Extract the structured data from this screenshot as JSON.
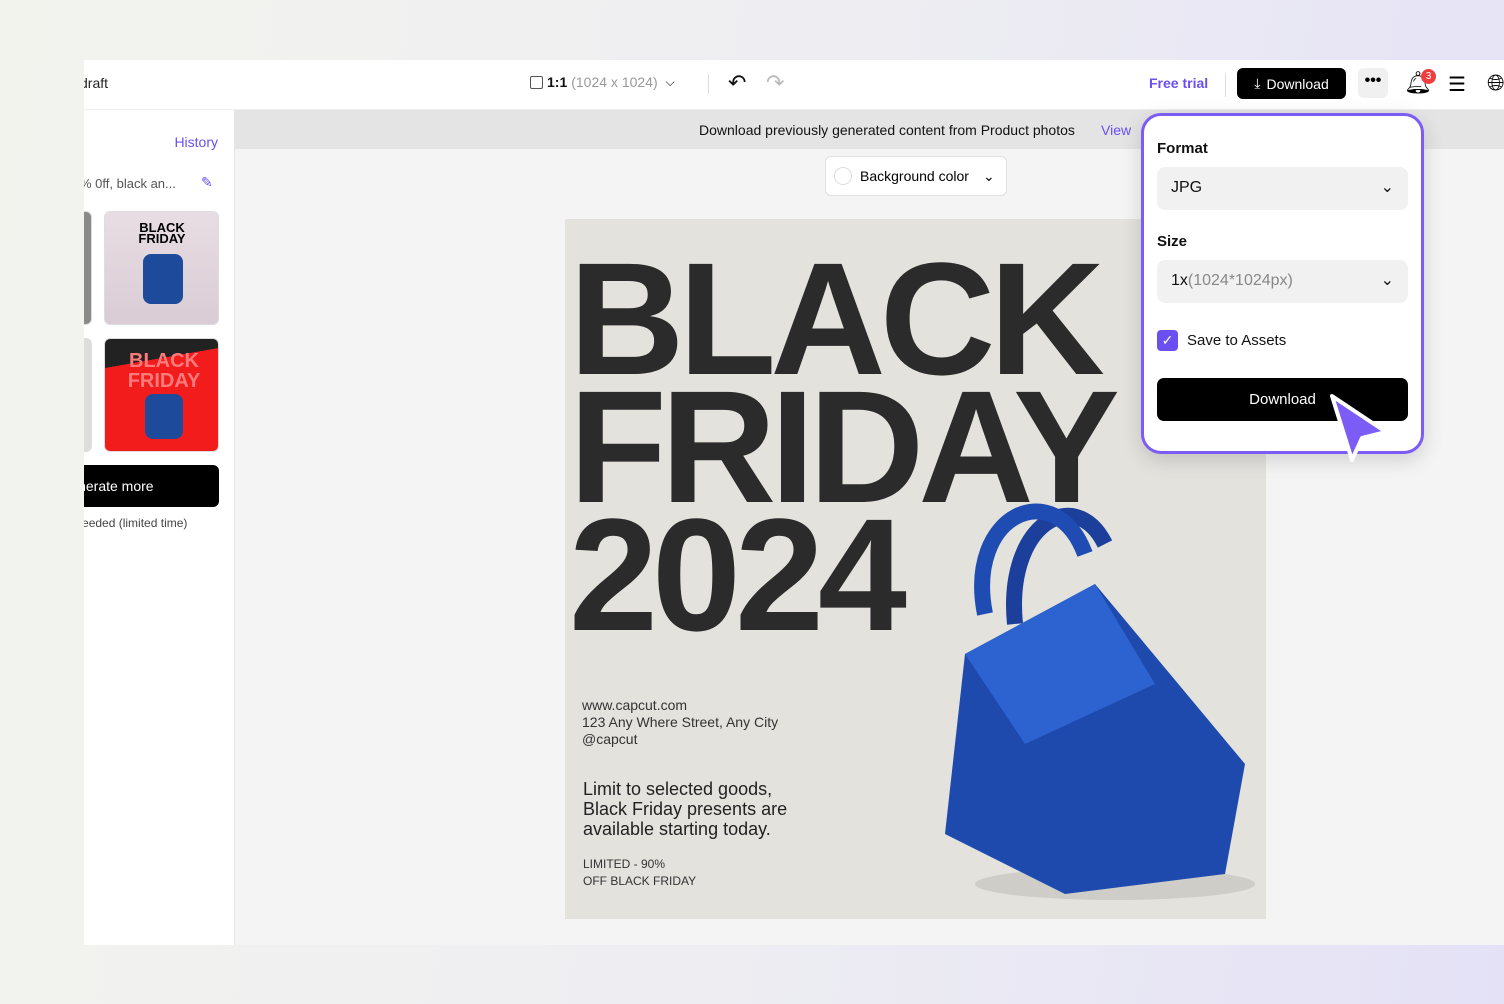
{
  "header": {
    "project_name": "draft",
    "ratio_label": "1:1",
    "ratio_size": "(1024 x 1024)",
    "free_trial": "Free trial",
    "download": "Download",
    "notification_count": "3"
  },
  "sidebar": {
    "history": "History",
    "prompt": "% 0ff, black an...",
    "generate_more": "Generate more",
    "note": "No credits needed (limited time)"
  },
  "banner": {
    "text": "Download previously generated content from Product photos",
    "link": "View"
  },
  "toolbar": {
    "background_color": "Background color"
  },
  "poster": {
    "line1": "BLACK",
    "line2": "FRIDAY",
    "line3": "2024",
    "website": "www.capcut.com",
    "address": "123 Any Where Street, Any City",
    "handle": "@capcut",
    "body1": "Limit to selected goods,",
    "body2": "Black Friday presents are",
    "body3": "available starting today.",
    "promo1": "LIMITED - 90%",
    "promo2": "OFF BLACK FRIDAY"
  },
  "thumbs": {
    "t1": "BLACK FRIDAY",
    "t2": "BLACK FRIDAY"
  },
  "popup": {
    "format_label": "Format",
    "format_value": "JPG",
    "size_label": "Size",
    "size_value_main": "1x",
    "size_value_detail": "(1024*1024px)",
    "save_to_assets": "Save to Assets",
    "save_checked": true,
    "download": "Download"
  },
  "colors": {
    "accent": "#7b5cf5",
    "badge": "#f03e3e",
    "primary_button": "#000000"
  }
}
